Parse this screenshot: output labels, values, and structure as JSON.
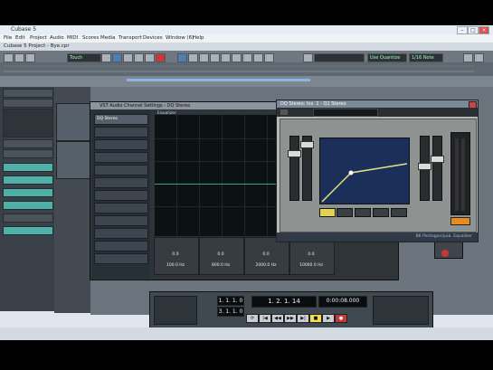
{
  "window": {
    "title": "Cubase 5"
  },
  "menu": [
    "File",
    "Edit",
    "Project",
    "Audio",
    "MIDI",
    "Scores",
    "Media",
    "Transport",
    "Devices",
    "Window (6)",
    "Help"
  ],
  "project": {
    "title": "Cubase 5 Project - Bye.cpr"
  },
  "toolbar": {
    "mode": "Touch",
    "snap": "Use Quantize",
    "grid": "1/16 Note"
  },
  "channel_window": {
    "title": "VST Audio Channel Settings - DQ Stereo",
    "track_name": "DQ Stereo",
    "panel_label": "Equalizer"
  },
  "eq_bands": [
    {
      "gain": "0.0",
      "freq": "100.0 Hz"
    },
    {
      "gain": "0.0",
      "freq": "800.0 Hz"
    },
    {
      "gain": "0.0",
      "freq": "2000.0 Hz"
    },
    {
      "gain": "0.0",
      "freq": "10000.0 Hz"
    }
  ],
  "plugin": {
    "title": "DQ Stereo: Ins. 1 - Q1 Stereo",
    "footer": "BK Pentagon/pub. Equalizer"
  },
  "transport": {
    "position": "1. 2. 1. 14",
    "locator_left": "1. 1. 1. 0",
    "locator_right": "3. 1. 1. 0",
    "time": "0:00:08.000"
  },
  "colors": {
    "accent": "#4fb0a8",
    "graph_bg": "#1b2f5a",
    "record": "#c7383a"
  }
}
